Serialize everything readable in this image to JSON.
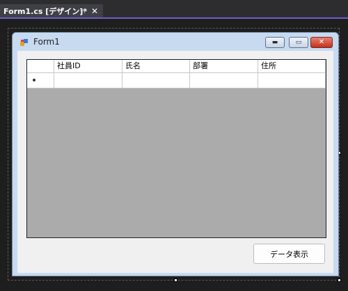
{
  "tab": {
    "title": "Form1.cs [デザイン]*",
    "pin_glyph": "⊣",
    "close_glyph": "✕"
  },
  "form": {
    "title": "Form1",
    "min_glyph": "▬",
    "max_glyph": "▭",
    "close_glyph": "✕"
  },
  "grid": {
    "columns": [
      "社員ID",
      "氏名",
      "部署",
      "住所"
    ],
    "new_row_marker": "*"
  },
  "button": {
    "label": "データ表示"
  },
  "colors": {
    "tab_accent": "#6a5fc8",
    "grid_background": "#ababab",
    "form_frame": "#c7daf0",
    "close_red": "#c0321e"
  }
}
